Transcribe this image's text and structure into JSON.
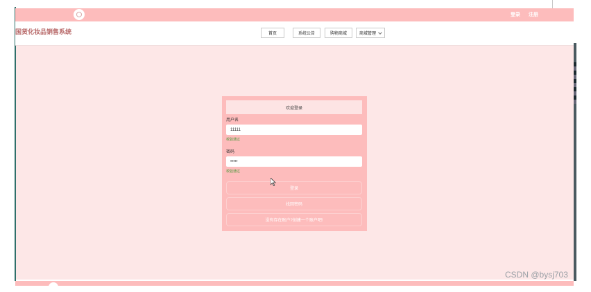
{
  "topbar": {
    "login_label": "登录",
    "register_label": "注册"
  },
  "header": {
    "site_title": "国货化妆品销售系统",
    "nav": {
      "home": "首页",
      "announcement": "系统公告",
      "mall": "购物商城",
      "mall_manage": "商城管理"
    }
  },
  "login": {
    "welcome": "欢迎登录",
    "username_label": "用户名",
    "username_value": "11111",
    "username_hint": "校验通过",
    "password_label": "密码",
    "password_value": "•••••",
    "password_hint": "校验通过",
    "login_button": "登录",
    "forgot_button": "找回密码",
    "register_link": "没有存在账户?创建一个账户吧!"
  },
  "watermark": "CSDN @bysj703",
  "icons": {
    "avatar": "avatar-icon",
    "dropdown": "chevron-down-icon",
    "cursor": "mouse-cursor-icon"
  },
  "colors": {
    "topbar": "#fdbcbc",
    "page_bg": "#fde7e7",
    "card": "#fdbcbc",
    "hint_green": "#4c9a3c",
    "title": "#b96b6b"
  }
}
